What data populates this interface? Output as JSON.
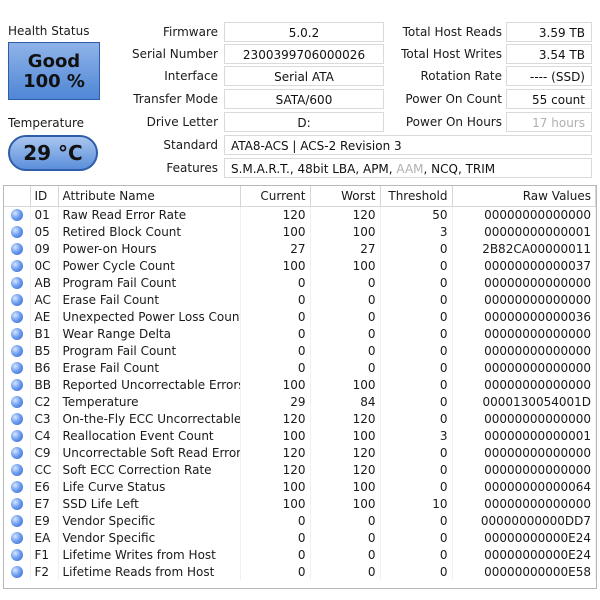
{
  "health": {
    "label": "Health Status",
    "status": "Good",
    "percent": "100 %"
  },
  "temperature": {
    "label": "Temperature",
    "value": "29 °C"
  },
  "info_left": [
    {
      "label": "Firmware",
      "value": "5.0.2"
    },
    {
      "label": "Serial Number",
      "value": "2300399706000026"
    },
    {
      "label": "Interface",
      "value": "Serial ATA"
    },
    {
      "label": "Transfer Mode",
      "value": "SATA/600"
    },
    {
      "label": "Drive Letter",
      "value": "D:"
    }
  ],
  "info_right": [
    {
      "label": "Total Host Reads",
      "value": "3.59 TB"
    },
    {
      "label": "Total Host Writes",
      "value": "3.54 TB"
    },
    {
      "label": "Rotation Rate",
      "value": "---- (SSD)"
    },
    {
      "label": "Power On Count",
      "value": "55 count"
    },
    {
      "label": "Power On Hours",
      "value": "17 hours"
    }
  ],
  "standard": {
    "label": "Standard",
    "value": "ATA8-ACS | ACS-2 Revision 3"
  },
  "features": {
    "label": "Features",
    "value_a": "S.M.A.R.T., 48bit LBA, APM, ",
    "value_b": "AAM",
    "value_c": ", NCQ, TRIM"
  },
  "table": {
    "headers": {
      "id": "ID",
      "name": "Attribute Name",
      "current": "Current",
      "worst": "Worst",
      "threshold": "Threshold",
      "raw": "Raw Values"
    },
    "status_icon": "blue-circle-icon",
    "rows": [
      {
        "id": "01",
        "name": "Raw Read Error Rate",
        "current": "120",
        "worst": "120",
        "threshold": "50",
        "raw": "00000000000000"
      },
      {
        "id": "05",
        "name": "Retired Block Count",
        "current": "100",
        "worst": "100",
        "threshold": "3",
        "raw": "00000000000001"
      },
      {
        "id": "09",
        "name": "Power-on Hours",
        "current": "27",
        "worst": "27",
        "threshold": "0",
        "raw": "2B82CA00000011"
      },
      {
        "id": "0C",
        "name": "Power Cycle Count",
        "current": "100",
        "worst": "100",
        "threshold": "0",
        "raw": "00000000000037"
      },
      {
        "id": "AB",
        "name": "Program Fail Count",
        "current": "0",
        "worst": "0",
        "threshold": "0",
        "raw": "00000000000000"
      },
      {
        "id": "AC",
        "name": "Erase Fail Count",
        "current": "0",
        "worst": "0",
        "threshold": "0",
        "raw": "00000000000000"
      },
      {
        "id": "AE",
        "name": "Unexpected Power Loss Count",
        "current": "0",
        "worst": "0",
        "threshold": "0",
        "raw": "00000000000036"
      },
      {
        "id": "B1",
        "name": "Wear Range Delta",
        "current": "0",
        "worst": "0",
        "threshold": "0",
        "raw": "00000000000000"
      },
      {
        "id": "B5",
        "name": "Program Fail Count",
        "current": "0",
        "worst": "0",
        "threshold": "0",
        "raw": "00000000000000"
      },
      {
        "id": "B6",
        "name": "Erase Fail Count",
        "current": "0",
        "worst": "0",
        "threshold": "0",
        "raw": "00000000000000"
      },
      {
        "id": "BB",
        "name": "Reported Uncorrectable Errors",
        "current": "100",
        "worst": "100",
        "threshold": "0",
        "raw": "00000000000000"
      },
      {
        "id": "C2",
        "name": "Temperature",
        "current": "29",
        "worst": "84",
        "threshold": "0",
        "raw": "0000130054001D"
      },
      {
        "id": "C3",
        "name": "On-the-Fly ECC Uncorrectable...",
        "current": "120",
        "worst": "120",
        "threshold": "0",
        "raw": "00000000000000"
      },
      {
        "id": "C4",
        "name": "Reallocation Event Count",
        "current": "100",
        "worst": "100",
        "threshold": "3",
        "raw": "00000000000001"
      },
      {
        "id": "C9",
        "name": "Uncorrectable Soft Read Error ...",
        "current": "120",
        "worst": "120",
        "threshold": "0",
        "raw": "00000000000000"
      },
      {
        "id": "CC",
        "name": "Soft ECC Correction Rate",
        "current": "120",
        "worst": "120",
        "threshold": "0",
        "raw": "00000000000000"
      },
      {
        "id": "E6",
        "name": "Life Curve Status",
        "current": "100",
        "worst": "100",
        "threshold": "0",
        "raw": "00000000000064"
      },
      {
        "id": "E7",
        "name": "SSD Life Left",
        "current": "100",
        "worst": "100",
        "threshold": "10",
        "raw": "00000000000000"
      },
      {
        "id": "E9",
        "name": "Vendor Specific",
        "current": "0",
        "worst": "0",
        "threshold": "0",
        "raw": "00000000000DD7"
      },
      {
        "id": "EA",
        "name": "Vendor Specific",
        "current": "0",
        "worst": "0",
        "threshold": "0",
        "raw": "00000000000E24"
      },
      {
        "id": "F1",
        "name": "Lifetime Writes from Host",
        "current": "0",
        "worst": "0",
        "threshold": "0",
        "raw": "00000000000E24"
      },
      {
        "id": "F2",
        "name": "Lifetime Reads from Host",
        "current": "0",
        "worst": "0",
        "threshold": "0",
        "raw": "00000000000E58"
      }
    ]
  }
}
